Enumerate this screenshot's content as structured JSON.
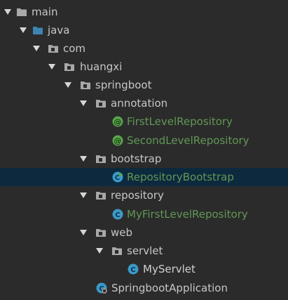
{
  "colors": {
    "background": "#2b2b2b",
    "selected_row": "#0d293e",
    "green_text": "#629755",
    "folder_blue": "#3d84b2",
    "package_gray": "#a9a9a9",
    "class_cyan": "#3a9ac9",
    "annotation_green": "#57a64a"
  },
  "tree": {
    "items": [
      {
        "label": "main",
        "icon": "folder-icon",
        "expanded": true
      },
      {
        "label": "java",
        "icon": "source-folder-icon",
        "expanded": true
      },
      {
        "label": "com",
        "icon": "package-icon",
        "expanded": true
      },
      {
        "label": "huangxi",
        "icon": "package-icon",
        "expanded": true
      },
      {
        "label": "springboot",
        "icon": "package-icon",
        "expanded": true
      },
      {
        "label": "annotation",
        "icon": "package-icon",
        "expanded": true
      },
      {
        "label": "FirstLevelRepository",
        "icon": "annotation-icon"
      },
      {
        "label": "SecondLevelRepository",
        "icon": "annotation-icon"
      },
      {
        "label": "bootstrap",
        "icon": "package-icon",
        "expanded": true
      },
      {
        "label": "RepositoryBootstrap",
        "icon": "runnable-class-icon",
        "selected": true
      },
      {
        "label": "repository",
        "icon": "package-icon",
        "expanded": true
      },
      {
        "label": "MyFirstLevelRepository",
        "icon": "class-icon"
      },
      {
        "label": "web",
        "icon": "package-icon",
        "expanded": true
      },
      {
        "label": "servlet",
        "icon": "package-icon",
        "expanded": true
      },
      {
        "label": "MyServlet",
        "icon": "class-icon"
      },
      {
        "label": "SpringbootApplication",
        "icon": "spring-boot-app-icon"
      }
    ]
  }
}
